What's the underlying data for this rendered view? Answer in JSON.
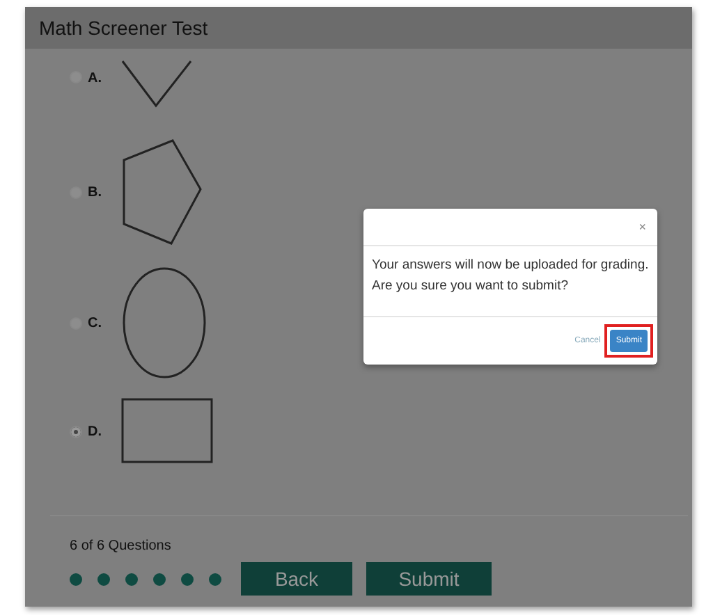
{
  "window": {
    "title": "Math Screener Test"
  },
  "options": [
    {
      "label": "A.",
      "kind": "v",
      "selected": false
    },
    {
      "label": "B.",
      "kind": "pentagon",
      "selected": false
    },
    {
      "label": "C.",
      "kind": "circle",
      "selected": false
    },
    {
      "label": "D.",
      "kind": "rectangle",
      "selected": true
    }
  ],
  "footer": {
    "progress": "6 of 6 Questions",
    "dots": [
      {
        "answered": true
      },
      {
        "answered": true
      },
      {
        "answered": true
      },
      {
        "answered": true
      },
      {
        "answered": true
      },
      {
        "answered": true
      }
    ],
    "buttons": [
      "Back",
      "Submit"
    ]
  },
  "dialog": {
    "close": "×",
    "message": "Your answers will now be uploaded for grading. Are you sure you want to submit?",
    "cancel": "Cancel",
    "submit": "Submit",
    "submit_highlighted": true
  }
}
